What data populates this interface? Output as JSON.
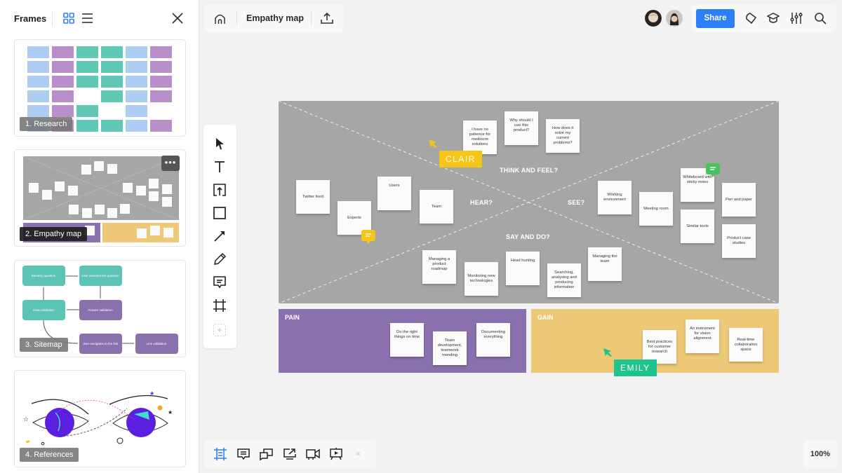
{
  "sidebar": {
    "title": "Frames",
    "view_grid_icon": "grid-view-icon",
    "view_list_icon": "list-view-icon",
    "close_icon": "close-icon",
    "frames": [
      {
        "label": "1. Research"
      },
      {
        "label": "2. Empathy map",
        "more_label": "•••"
      },
      {
        "label": "3. Sitemap",
        "nodes": [
          "Security question",
          "User answers the question",
          "Data validation",
          "Answer validation",
          "User navigates to the link",
          "Link validation"
        ]
      },
      {
        "label": "4. References"
      }
    ]
  },
  "topbar": {
    "home_icon": "home-icon",
    "board_title": "Empathy map",
    "upload_icon": "upload-icon",
    "share_label": "Share",
    "icons": [
      "tag-icon",
      "graduation-cap-icon",
      "settings-sliders-icon",
      "search-icon"
    ]
  },
  "toolbar": {
    "tools": [
      "select-tool",
      "text-tool",
      "upload-tool",
      "shape-tool",
      "arrow-tool",
      "pen-tool",
      "comment-tool",
      "frame-tool",
      "add-tool"
    ]
  },
  "bottombar": {
    "icons": [
      "frames-icon",
      "comments-icon",
      "chat-icon",
      "share-screen-icon",
      "video-icon",
      "presentation-icon"
    ],
    "collapse_label": "«",
    "zoom_level": "100%"
  },
  "board": {
    "colors": {
      "board": "#a6a6a6",
      "pain": "#8a70ad",
      "gain": "#edc876",
      "share": "#2d7ff9",
      "clair": "#f5c518",
      "emily": "#1ec48f",
      "comment_yellow": "#f5c518",
      "comment_green": "#4cc160"
    },
    "sections": {
      "think": "THINK AND FEEL?",
      "hear": "HEAR?",
      "see": "SEE?",
      "say": "SAY AND DO?"
    },
    "stickies": {
      "think": [
        "I have no patience for mediocre solutions",
        "Why should I use this product?",
        "How does it solve my current problems?"
      ],
      "hear": [
        "Twitter feed",
        "Experts",
        "Users",
        "Team"
      ],
      "see": [
        "Working environment",
        "Meeting room",
        "Whiteboard with sticky notes",
        "Similar tools",
        "Pen and paper",
        "Product case studies"
      ],
      "say": [
        "Managing a product roadmap",
        "Monitoring new technologies",
        "Head hunting",
        "Searching, analysing and producing information",
        "Managing the team"
      ]
    },
    "pain": {
      "label": "PAIN",
      "stickies": [
        "Do the right things on time",
        "Team development, teamwork mending",
        "Documenting everything"
      ]
    },
    "gain": {
      "label": "GAIN",
      "stickies": [
        "Best practices for customer research",
        "An instrument for vision alignment",
        "Real-time collaboration space"
      ]
    },
    "cursors": [
      {
        "name": "CLAIR"
      },
      {
        "name": "EMILY"
      }
    ]
  }
}
